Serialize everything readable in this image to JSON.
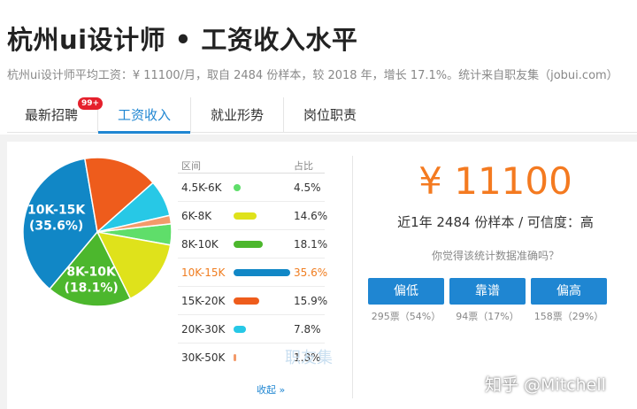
{
  "header": {
    "title": "杭州ui设计师 • 工资收入水平",
    "subtitle": "杭州ui设计师平均工资：¥ 11100/月，取自 2484 份样本，较 2018 年，增长 17.1%。统计来自职友集（jobui.com）"
  },
  "tabs": [
    {
      "label": "最新招聘",
      "badge": "99+"
    },
    {
      "label": "工资收入"
    },
    {
      "label": "就业形势"
    },
    {
      "label": "岗位职责"
    }
  ],
  "table": {
    "header_range": "区间",
    "header_pct": "占比",
    "collapse_label": "收起 »",
    "watermark": "职友集"
  },
  "summary": {
    "salary": "¥ 11100",
    "info": "近1年 2484 份样本 / 可信度：高",
    "question": "你觉得该统计数据准确吗？"
  },
  "votes": [
    {
      "label": "偏低",
      "count": "295票（54%）"
    },
    {
      "label": "靠谱",
      "count": "94票（17%）"
    },
    {
      "label": "偏高",
      "count": "158票（29%）"
    }
  ],
  "credit": "知乎 @Mitchell",
  "colors": {
    "accent": "#1f86d2",
    "salary": "#f47a20",
    "badge": "#e5202c"
  },
  "chart_data": {
    "type": "pie",
    "categories": [
      "4.5K-6K",
      "6K-8K",
      "8K-10K",
      "10K-15K",
      "15K-20K",
      "20K-30K",
      "30K-50K"
    ],
    "values": [
      4.5,
      14.6,
      18.1,
      35.6,
      15.9,
      7.8,
      1.8
    ],
    "pct_labels": [
      "4.5%",
      "14.6%",
      "18.1%",
      "35.6%",
      "15.9%",
      "7.8%",
      "1.8%"
    ],
    "colors": [
      "#5fde6a",
      "#dfe21b",
      "#4cb72d",
      "#1187c6",
      "#ee5c1c",
      "#27c8e6",
      "#f39a6a"
    ],
    "slice_labels": [
      {
        "index": 3,
        "text": "10K-15K\n(35.6%)"
      },
      {
        "index": 2,
        "text": "8K-10K\n(18.1%)"
      }
    ],
    "highlight_index": 3,
    "max_value": 35.6
  }
}
